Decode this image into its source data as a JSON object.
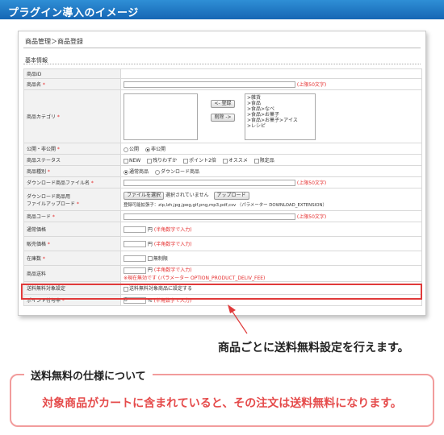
{
  "banner": {
    "title": "プラグイン導入のイメージ"
  },
  "screen": {
    "breadcrumb": "商品管理＞商品登録",
    "section": "基本情報",
    "fields": {
      "product_id": "商品ID",
      "product_name": "商品名",
      "product_name_note": "(上限50文字)",
      "category": "商品カテゴリ",
      "category_add": "<- 登録",
      "category_remove": "削除 ->",
      "category_items": [
        ">雑貨",
        ">食品",
        ">食品>なべ",
        ">食品>お菓子",
        ">食品>お菓子>アイス",
        ">レシピ"
      ],
      "publish": "公開・非公開",
      "publish_opts": [
        "公開",
        "非公開"
      ],
      "status": "商品ステータス",
      "status_opts": [
        "NEW",
        "残りわずか",
        "ポイント2倍",
        "オススメ",
        "限定品"
      ],
      "type": "商品種別",
      "type_opts": [
        "通常商品",
        "ダウンロード商品"
      ],
      "dl_name": "ダウンロード商品ファイル名",
      "dl_name_note": "(上限50文字)",
      "dl_upload": "ダウンロード商品用",
      "dl_upload2": "ファイルアップロード",
      "file_button": "ファイルを選択",
      "file_none": "選択されていません",
      "upload_button": "アップロード",
      "ext_note": "登録可能拡張子：zip,lzh,jpg,jpeg,gif,png,mp3,pdf,csv （パラメーター DOWNLOAD_EXTENSION）",
      "code": "商品コード",
      "code_note": "(上限50文字)",
      "normal_price": "通常価格",
      "sale_price": "販売価格",
      "yen": "円",
      "price_note": "(半角数字で入力)",
      "stock": "在庫数",
      "unlimited": "無制限",
      "shipping": "商品送料",
      "shipping_note": "※現在無効です (パラメーター OPTION_PRODUCT_DELIV_FEE)",
      "free_shipping": "送料無料対象設定",
      "free_shipping_opt": "送料無料対象商品に設定する",
      "point_rate": "ポイント付与率",
      "point_value": "0",
      "percent": "%"
    }
  },
  "caption": "商品ごとに送料無料設定を行えます。",
  "spec": {
    "title": "送料無料の仕様について",
    "body": "対象商品がカートに含まれていると、その注文は送料無料になります。"
  },
  "colors": {
    "banner": "#1e78c8",
    "highlight": "#e03a3a",
    "spec_border": "#f29c9c",
    "spec_text": "#e54b4b"
  }
}
